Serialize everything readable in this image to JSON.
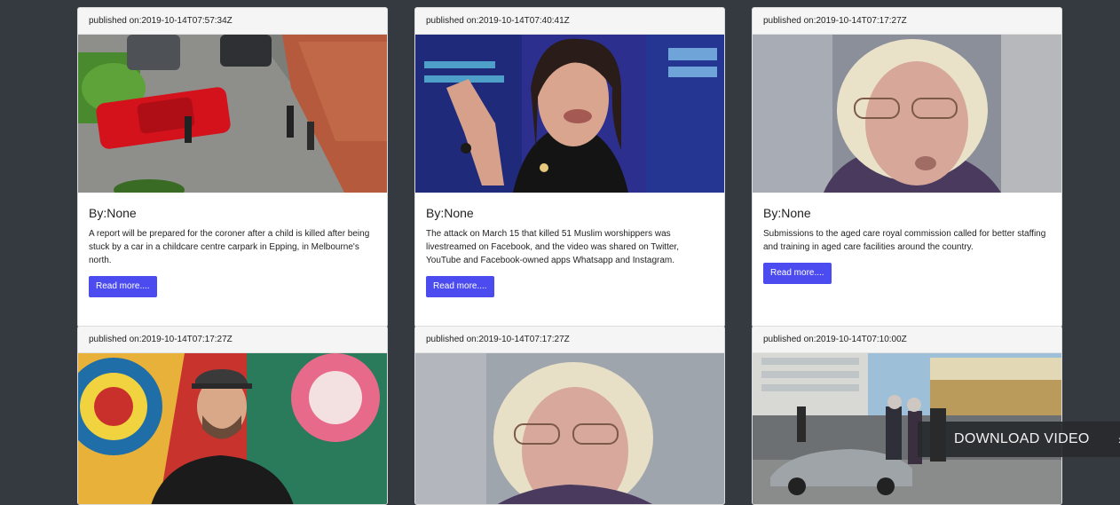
{
  "cards": [
    {
      "published": "published on:2019-10-14T07:57:34Z",
      "image_desc": "red-car-carpark-icon",
      "author": "By:None",
      "description": "A report will be prepared for the coroner after a child is killed after being stuck by a car in a childcare centre carpark in Epping, in Melbourne's north.",
      "button_label": "Read more...."
    },
    {
      "published": "published on:2019-10-14T07:40:41Z",
      "image_desc": "speaker-portrait-icon",
      "author": "By:None",
      "description": "The attack on March 15 that killed 51 Muslim worshippers was livestreamed on Facebook, and the video was shared on Twitter, YouTube and Facebook-owned apps Whatsapp and Instagram.",
      "button_label": "Read more...."
    },
    {
      "published": "published on:2019-10-14T07:17:27Z",
      "image_desc": "elderly-woman-portrait-icon",
      "author": "By:None",
      "description": "Submissions to the aged care royal commission called for better staffing and training in aged care facilities around the country.",
      "button_label": "Read more...."
    },
    {
      "published": "published on:2019-10-14T07:17:27Z",
      "image_desc": "man-mural-portrait-icon"
    },
    {
      "published": "published on:2019-10-14T07:17:27Z",
      "image_desc": "elderly-woman-portrait-icon"
    },
    {
      "published": "published on:2019-10-14T07:10:00Z",
      "image_desc": "street-scene-icon"
    }
  ],
  "overlay": {
    "download_label": "DOWNLOAD VIDEO"
  }
}
